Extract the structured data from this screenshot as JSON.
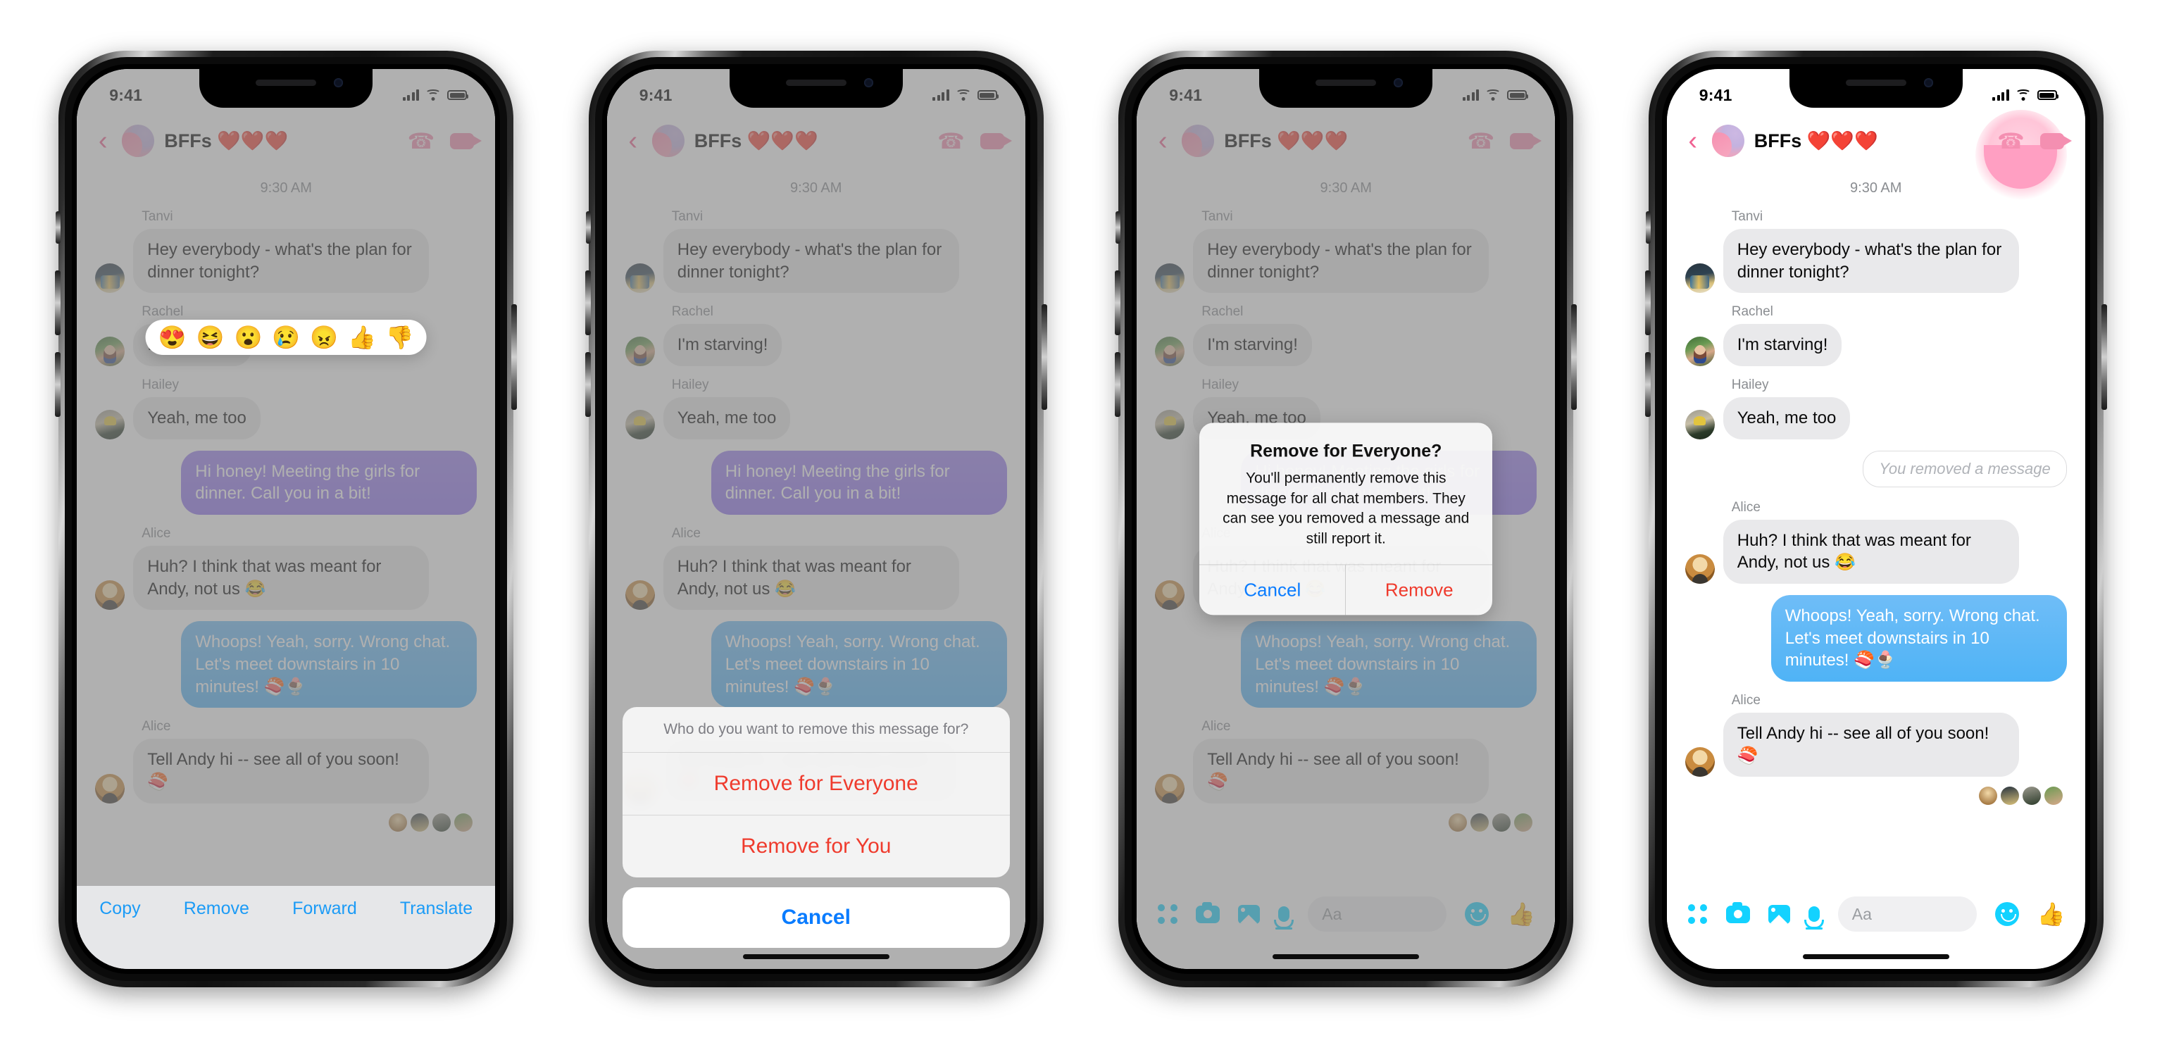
{
  "status_bar": {
    "time": "9:41",
    "signal_icon": "cellular-signal-icon",
    "wifi_icon": "wifi-icon",
    "battery_icon": "battery-icon"
  },
  "header": {
    "back_icon": "chevron-left-icon",
    "avatar": "group-avatar",
    "title": "BFFs ❤️❤️❤️",
    "call_icon": "phone-call-icon",
    "video_icon": "video-call-icon"
  },
  "thread": {
    "timestamp": "9:30 AM",
    "messages": [
      {
        "sender": "Tanvi",
        "text": "Hey everybody - what's the plan for dinner tonight?",
        "side": "them",
        "style": "grey",
        "avatar": "tanvi"
      },
      {
        "sender": "Rachel",
        "text": "I'm starving!",
        "side": "them",
        "style": "grey",
        "avatar": "rachel"
      },
      {
        "sender": "Hailey",
        "text": "Yeah, me too",
        "side": "them",
        "style": "grey",
        "avatar": "hailey"
      },
      {
        "sender": "",
        "text": "Hi honey! Meeting the girls for dinner. Call you in a bit!",
        "side": "me",
        "style": "purple",
        "avatar": ""
      },
      {
        "sender": "Alice",
        "text": "Huh? I think that was meant for Andy, not us 😂",
        "side": "them",
        "style": "grey",
        "avatar": "alice"
      },
      {
        "sender": "",
        "text": "Whoops! Yeah, sorry. Wrong chat. Let's meet downstairs in 10 minutes! 🍣🍨",
        "side": "me",
        "style": "blue",
        "avatar": ""
      },
      {
        "sender": "Alice",
        "text": "Tell Andy hi -- see all of you soon! 🍣",
        "side": "them",
        "style": "grey",
        "avatar": "alice"
      }
    ],
    "removed_notice": "You removed a message",
    "seen_by": [
      "alice",
      "tanvi",
      "hailey",
      "rachel"
    ]
  },
  "reaction_bar": {
    "emojis": [
      "😍",
      "😆",
      "😮",
      "😢",
      "😠",
      "👍",
      "👎"
    ],
    "names": [
      "love-reaction",
      "haha-reaction",
      "wow-reaction",
      "sad-reaction",
      "angry-reaction",
      "thumbs-up-reaction",
      "thumbs-down-reaction"
    ]
  },
  "message_actions": {
    "items": [
      "Copy",
      "Remove",
      "Forward",
      "Translate"
    ],
    "accent_color": "#1b9bf6"
  },
  "action_sheet": {
    "title": "Who do you want to remove this message for?",
    "option_everyone": "Remove for Everyone",
    "option_you": "Remove for You",
    "cancel": "Cancel",
    "destructive_color": "#ef3b2d",
    "cancel_color": "#0a7cff"
  },
  "alert": {
    "title": "Remove for Everyone?",
    "message": "You'll permanently remove this message for all chat members. They can see you removed a message and still report it.",
    "cancel": "Cancel",
    "confirm": "Remove",
    "cancel_color": "#0a7cff",
    "confirm_color": "#ef3b2d"
  },
  "composer": {
    "grid_icon": "apps-grid-icon",
    "camera_icon": "camera-icon",
    "gallery_icon": "photo-gallery-icon",
    "mic_icon": "microphone-icon",
    "placeholder": "Aa",
    "emoji_icon": "emoji-smiley-icon",
    "like_icon": "thumbs-up-icon",
    "accent_color": "#13d2ff"
  },
  "phones": [
    {
      "id": "phone-1-message-actions"
    },
    {
      "id": "phone-2-action-sheet"
    },
    {
      "id": "phone-3-confirm-alert"
    },
    {
      "id": "phone-4-removed-result"
    }
  ]
}
